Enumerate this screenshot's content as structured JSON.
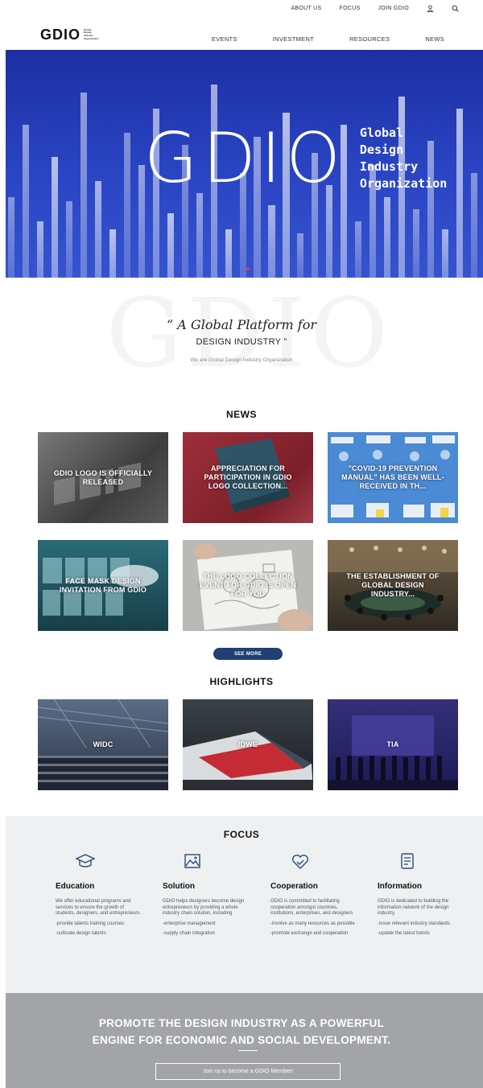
{
  "header": {
    "top_links": [
      "ABOUT US",
      "FOCUS",
      "JOIN GDIO"
    ],
    "logo_mark": "GDIO",
    "logo_sub": [
      "Global",
      "Design",
      "Industry",
      "Organization"
    ],
    "main_nav": [
      "EVENTS",
      "INVESTMENT",
      "RESOURCES",
      "NEWS"
    ]
  },
  "hero": {
    "mark": "GDIO",
    "lines": [
      "Global",
      "Design",
      "Industry",
      "Organization"
    ]
  },
  "slogan": {
    "bg_text": "GDIO",
    "line1": "“ A Global Platform for",
    "line2": "DESIGN INDUSTRY ”",
    "line3": "We are Global Design Industry Organization"
  },
  "news": {
    "title": "NEWS",
    "items": [
      "GDIO LOGO IS OFFICIALLY RELEASED",
      "APPRECIATION FOR PARTICIPATION IN GDIO LOGO COLLECTION...",
      "\"COVID-19 PREVENTION MANUAL\" HAS BEEN WELL-RECEIVED IN TH...",
      "FACE MASK DESIGN INVITATION FROM GDIO",
      "THE LOGO COLLECTION EVENT FOR GDIO IS OPEN FOR YOU",
      "THE ESTABLISHMENT OF GLOBAL DESIGN INDUSTRY..."
    ],
    "see_more": "SEE MORE"
  },
  "highlights": {
    "title": "HIGHLIGHTS",
    "items": [
      "WIDC",
      "IDWE",
      "TIA"
    ]
  },
  "focus": {
    "title": "FOCUS",
    "columns": [
      {
        "icon": "graduation-cap-icon",
        "heading": "Education",
        "body": "We offer educational programs and services to ensure the growth of students, designers, and entrepreneurs.",
        "items": [
          "-provide talents training courses",
          "-cultivate design talents"
        ]
      },
      {
        "icon": "landscape-icon",
        "heading": "Solution",
        "body": "GDIO helps designers become design entrepreneurs by providing a whole industry chain solution, including",
        "items": [
          "-enterprise management",
          "-supply chain integration"
        ]
      },
      {
        "icon": "handshake-heart-icon",
        "heading": "Cooperation",
        "body": "GDIO is committed to facilitating cooperation amongst countries, institutions, enterprises, and designers",
        "items": [
          "-involve as many resources as possible",
          "-promote exchange and cooperation"
        ]
      },
      {
        "icon": "document-icon",
        "heading": "Information",
        "body": "GDIO is dedicated to building the information network of the design industry.",
        "items": [
          "-issue relevant industry standards",
          "-update the latest trends"
        ]
      }
    ]
  },
  "promo": {
    "line1": "PROMOTE THE DESIGN INDUSTRY AS A POWERFUL",
    "line2": "ENGINE FOR ECONOMIC AND SOCIAL DEVELOPMENT.",
    "button": "Join us to become a GDIO Member!"
  }
}
